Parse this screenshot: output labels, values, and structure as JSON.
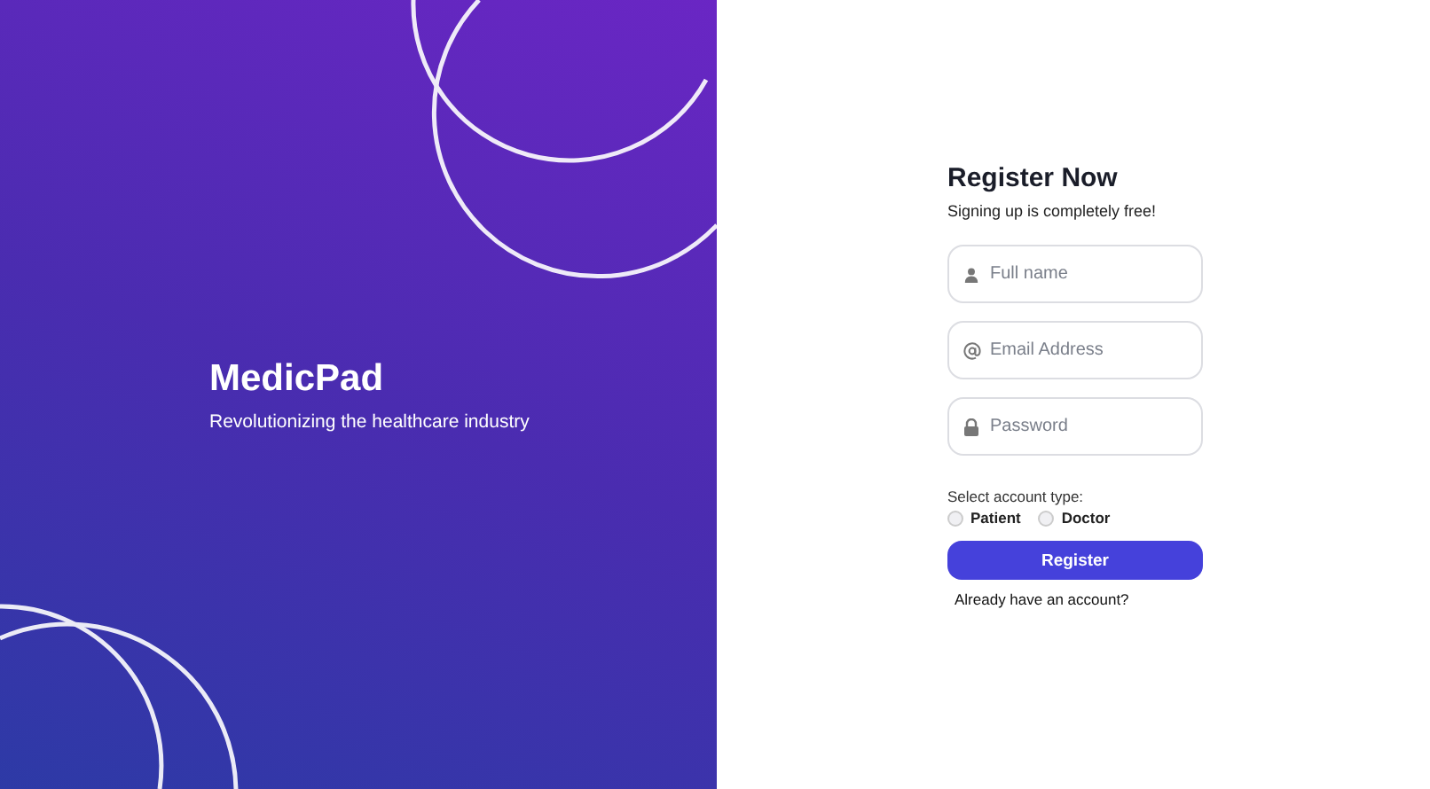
{
  "brand": {
    "name": "MedicPad",
    "tagline": "Revolutionizing the healthcare industry"
  },
  "form": {
    "title": "Register Now",
    "subtitle": "Signing up is completely free!",
    "fields": [
      {
        "kind": "person",
        "placeholder": "Full name"
      },
      {
        "kind": "email",
        "placeholder": "Email Address"
      },
      {
        "kind": "password",
        "placeholder": "Password"
      }
    ],
    "account_type_label": "Select account type:",
    "account_types": [
      {
        "label": "Patient",
        "selected": false
      },
      {
        "label": "Doctor",
        "selected": false
      }
    ],
    "submit": "Register",
    "login_link": "Already have an account?"
  }
}
